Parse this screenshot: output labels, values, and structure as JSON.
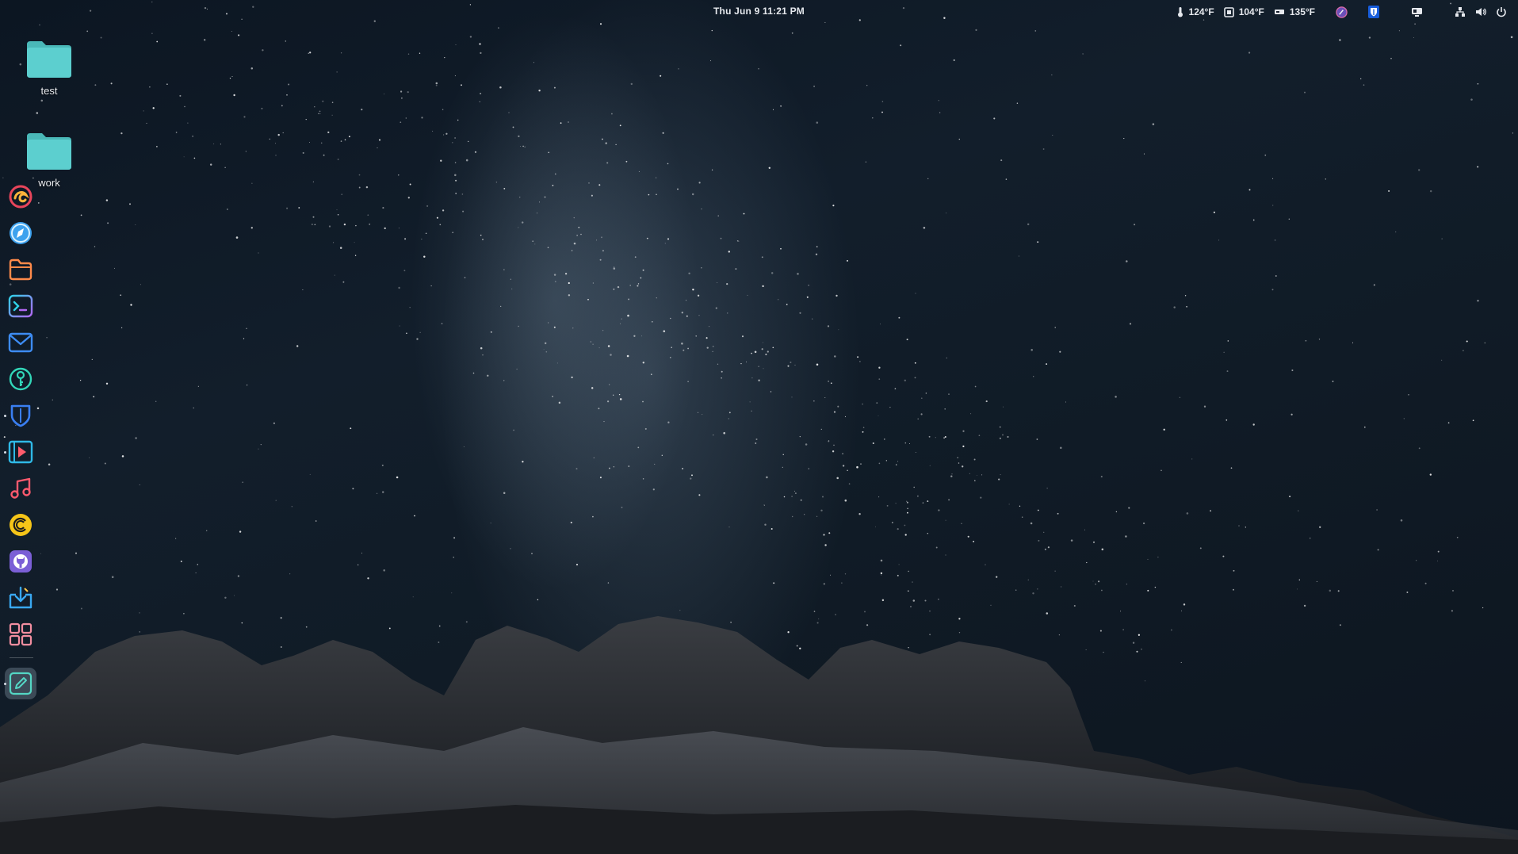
{
  "topbar": {
    "clock": "Thu Jun 9  11:21 PM",
    "sensors": [
      {
        "icon": "thermometer-icon",
        "value": "124°F"
      },
      {
        "icon": "cpu-chip-icon",
        "value": "104°F"
      },
      {
        "icon": "drive-icon",
        "value": "135°F"
      }
    ],
    "tray_icons": [
      "color-picker-icon",
      "bitwarden-icon",
      "display-icon",
      "network-icon",
      "volume-icon",
      "power-icon"
    ]
  },
  "desktop": {
    "icons": [
      {
        "name": "test",
        "icon": "folder-icon"
      },
      {
        "name": "work",
        "icon": "folder-icon"
      }
    ]
  },
  "dock": {
    "apps": [
      {
        "name": "Firefox",
        "icon": "firefox-icon",
        "running": false
      },
      {
        "name": "Web Browser",
        "icon": "browser-compass-icon",
        "running": false
      },
      {
        "name": "Files",
        "icon": "files-folder-icon",
        "running": false
      },
      {
        "name": "Terminal",
        "icon": "terminal-icon",
        "running": false
      },
      {
        "name": "Mail",
        "icon": "mail-icon",
        "running": false
      },
      {
        "name": "Passwords",
        "icon": "key-icon",
        "running": false
      },
      {
        "name": "Bitwarden",
        "icon": "shield-icon",
        "running": true
      },
      {
        "name": "Media Player",
        "icon": "media-player-icon",
        "running": true
      },
      {
        "name": "Music",
        "icon": "music-note-icon",
        "running": false
      },
      {
        "name": "Spiral App",
        "icon": "spiral-icon",
        "running": false
      },
      {
        "name": "GitHub",
        "icon": "github-icon",
        "running": false
      },
      {
        "name": "Software Installer",
        "icon": "download-box-icon",
        "running": false
      },
      {
        "name": "App Grid",
        "icon": "app-grid-icon",
        "running": false
      },
      {
        "name": "Text Editor",
        "icon": "text-editor-icon",
        "running": true,
        "active": true
      }
    ]
  },
  "colors": {
    "folder": "#5ccfcf",
    "text": "#e6e9ee",
    "sky_dark": "#0d151f"
  }
}
